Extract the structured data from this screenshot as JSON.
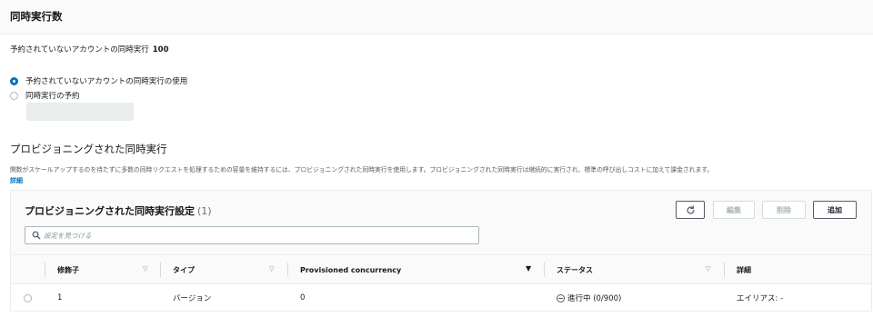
{
  "header": {
    "title": "同時実行数"
  },
  "unreserved": {
    "label": "予約されていないアカウントの同時実行",
    "value": "100"
  },
  "options": [
    {
      "label": "予約されていないアカウントの同時実行の使用",
      "selected": true
    },
    {
      "label": "同時実行の予約",
      "selected": false
    }
  ],
  "provisioned": {
    "title": "プロビジョニングされた同時実行",
    "description": "関数がスケールアップするのを待たずに多数の同時リクエストを処理するための容量を維持するには、プロビジョニングされた同時実行を使用します。プロビジョニングされた同時実行は継続的に実行され、標準の呼び出しコストに加えて課金されます。",
    "detail_link": "詳細"
  },
  "panel": {
    "title": "プロビジョニングされた同時実行設定",
    "count": "(1)",
    "refresh_icon": "refresh-icon",
    "edit_label": "編集",
    "delete_label": "削除",
    "add_label": "追加",
    "search_placeholder": "設定を見つける",
    "columns": [
      "修飾子",
      "タイプ",
      "Provisioned concurrency",
      "ステータス",
      "詳細"
    ],
    "rows": [
      {
        "qualifier": "1",
        "type": "バージョン",
        "provisioned": "0",
        "status": "進行中 (0/900)",
        "detail": "エイリアス: -"
      }
    ]
  },
  "colors": {
    "accent": "#0073bb",
    "text": "#16191f",
    "muted": "#879596",
    "border": "#eaeded"
  }
}
